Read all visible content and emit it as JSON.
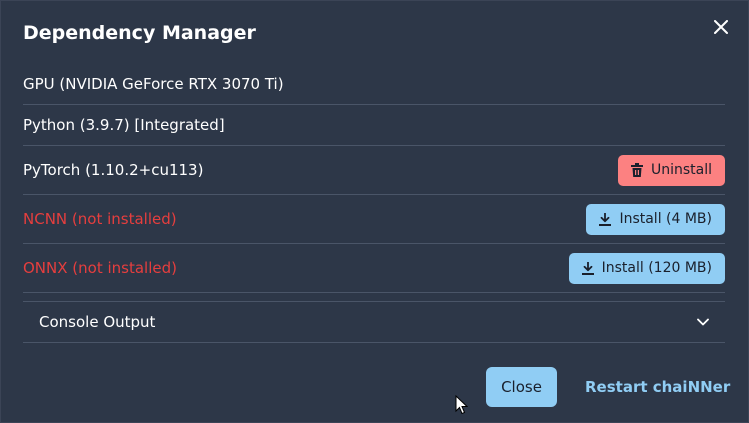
{
  "dialog": {
    "title": "Dependency Manager",
    "close_icon": "close-icon"
  },
  "dependencies": [
    {
      "label": "GPU (NVIDIA GeForce RTX 3070 Ti)"
    },
    {
      "label": "Python (3.9.7) [Integrated]"
    },
    {
      "label": "PyTorch (1.10.2+cu113)",
      "action_label": "Uninstall",
      "action_icon": "trash-icon"
    },
    {
      "label": "NCNN (not installed)",
      "action_label": "Install (4 MB)",
      "action_icon": "download-icon"
    },
    {
      "label": "ONNX (not installed)",
      "action_label": "Install (120 MB)",
      "action_icon": "download-icon"
    }
  ],
  "console": {
    "label": "Console Output",
    "icon": "chevron-down-icon"
  },
  "footer": {
    "close_label": "Close",
    "restart_label": "Restart chaiNNer"
  },
  "colors": {
    "background": "#2d3748",
    "error_text": "#e53e3e",
    "uninstall_button": "#fc8181",
    "install_button": "#90cdf4",
    "link": "#90cdf4"
  }
}
